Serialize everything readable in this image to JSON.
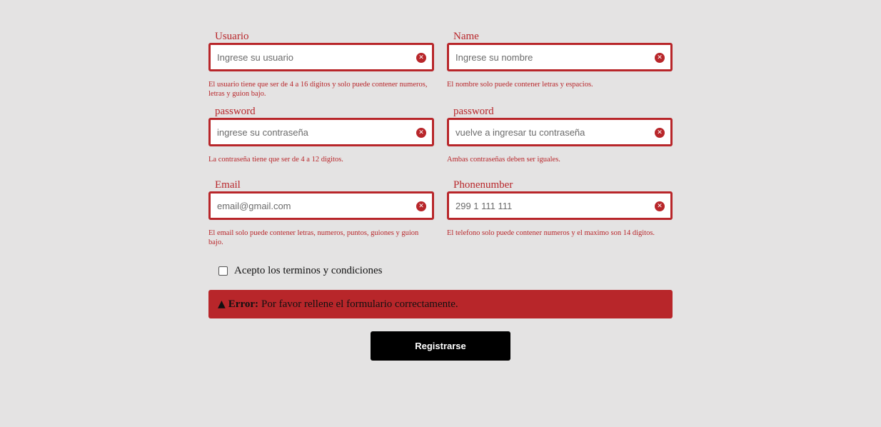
{
  "fields": [
    {
      "label": "Usuario",
      "placeholder": "Ingrese su usuario",
      "hint": "El usuario tiene que ser de 4 a 16 digitos y solo puede contener numeros, letras y guion bajo."
    },
    {
      "label": "Name",
      "placeholder": "Ingrese su nombre",
      "hint": "El nombre solo puede contener letras y espacios."
    },
    {
      "label": "password",
      "placeholder": "ingrese su contraseña",
      "hint": "La contraseña tiene que ser de 4 a 12 digitos."
    },
    {
      "label": "password",
      "placeholder": "vuelve a ingresar tu contraseña",
      "hint": "Ambas contraseñas deben ser iguales."
    },
    {
      "label": "Email",
      "placeholder": "email@gmail.com",
      "hint": "El email solo puede contener letras, numeros, puntos, guiones y guion bajo."
    },
    {
      "label": "Phonenumber",
      "placeholder": "299 1 111 111",
      "hint": "El telefono solo puede contener numeros y el maximo son 14 digitos."
    }
  ],
  "terms": {
    "label": "Acepto los terminos y condiciones",
    "checked": false
  },
  "alert": {
    "title": "Error:",
    "message": "Por favor rellene el formulario correctamente."
  },
  "submit": {
    "label": "Registrarse"
  },
  "colors": {
    "error": "#b8262a",
    "background": "#e4e3e3",
    "button": "#000000"
  }
}
